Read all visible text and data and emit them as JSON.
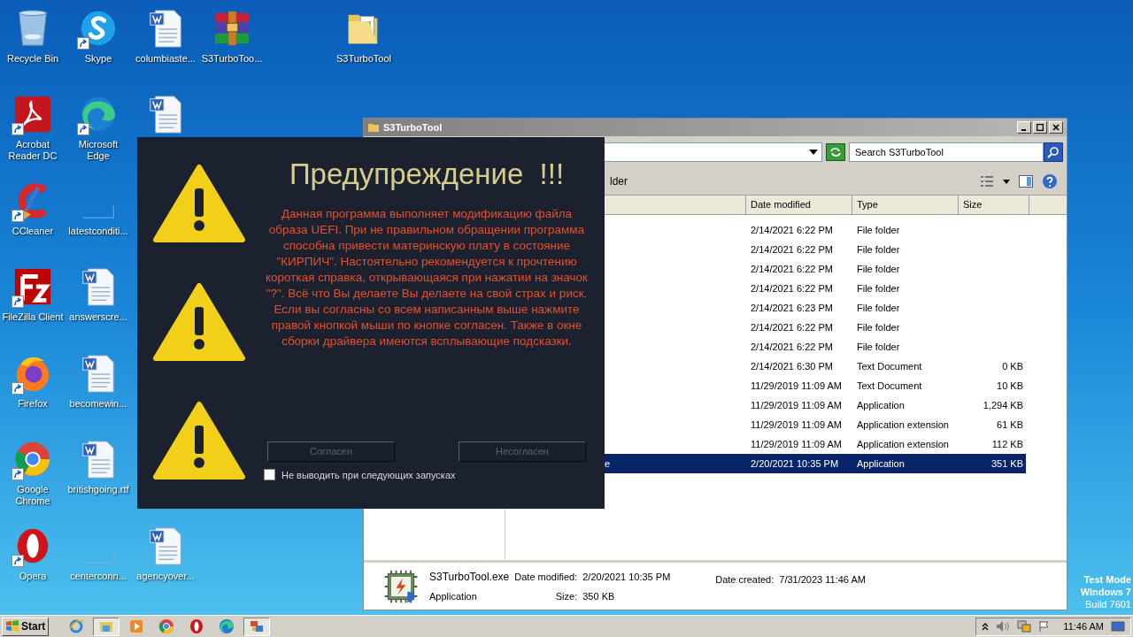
{
  "desktop": {
    "icons": [
      {
        "label": "Recycle Bin",
        "kind": "recycle",
        "shortcut": false
      },
      {
        "label": "Skype",
        "kind": "skype",
        "shortcut": true
      },
      {
        "label": "columbiaste...",
        "kind": "word",
        "shortcut": false
      },
      {
        "label": "S3TurboToo...",
        "kind": "archive",
        "shortcut": false
      },
      {
        "label": "S3TurboTool",
        "kind": "folder",
        "shortcut": false
      },
      {
        "label": "Acrobat Reader DC",
        "kind": "acrobat",
        "shortcut": true
      },
      {
        "label": "Microsoft Edge",
        "kind": "edge",
        "shortcut": true
      },
      {
        "kind": "word",
        "shortcut": false
      },
      {
        "label": "CCleaner",
        "kind": "ccleaner",
        "shortcut": true
      },
      {
        "label": "latestconditi...",
        "kind": "blank",
        "shortcut": false
      },
      {
        "label": "FileZilla Client",
        "kind": "filezilla",
        "shortcut": true
      },
      {
        "label": "answerscre...",
        "kind": "word",
        "shortcut": false
      },
      {
        "label": "Firefox",
        "kind": "firefox",
        "shortcut": true
      },
      {
        "label": "becomewin...",
        "kind": "word",
        "shortcut": false
      },
      {
        "label": "Google Chrome",
        "kind": "chrome",
        "shortcut": true
      },
      {
        "label": "britishgoing.rtf",
        "kind": "word",
        "shortcut": false
      },
      {
        "label": "Opera",
        "kind": "opera",
        "shortcut": true
      },
      {
        "label": "centerconn...",
        "kind": "blank",
        "shortcut": false
      },
      {
        "label": "agencyover...",
        "kind": "word",
        "shortcut": false
      }
    ],
    "watermark_text": [
      "Test Mode",
      "Windows 7",
      "Build 7601"
    ]
  },
  "explorer": {
    "title": "S3TurboTool",
    "search": {
      "placeholder": "Search S3TurboTool"
    },
    "toolbar_text": "lder",
    "columns": [
      "Date modified",
      "Type",
      "Size"
    ],
    "rows": [
      {
        "date": "2/14/2021 6:22 PM",
        "type": "File folder",
        "selected": false
      },
      {
        "date": "2/14/2021 6:22 PM",
        "type": "File folder",
        "selected": false
      },
      {
        "date": "2/14/2021 6:22 PM",
        "type": "File folder",
        "selected": false
      },
      {
        "date": "2/14/2021 6:22 PM",
        "type": "File folder",
        "selected": false
      },
      {
        "date": "2/14/2021 6:23 PM",
        "type": "File folder",
        "selected": false
      },
      {
        "date": "2/14/2021 6:22 PM",
        "type": "File folder",
        "selected": false
      },
      {
        "date": "2/14/2021 6:22 PM",
        "type": "File folder",
        "selected": false
      },
      {
        "date": "2/14/2021 6:30 PM",
        "type": "Text Document",
        "size": "0 KB",
        "selected": false
      },
      {
        "date": "11/29/2019 11:09 AM",
        "type": "Text Document",
        "size": "10 KB",
        "selected": false
      },
      {
        "date": "11/29/2019 11:09 AM",
        "type": "Application",
        "size": "1,294 KB",
        "selected": false
      },
      {
        "date": "11/29/2019 11:09 AM",
        "type": "Application extension",
        "size": "61 KB",
        "selected": false
      },
      {
        "date": "11/29/2019 11:09 AM",
        "type": "Application extension",
        "size": "112 KB",
        "selected": false
      },
      {
        "name": "e",
        "date": "2/20/2021 10:35 PM",
        "type": "Application",
        "size": "351 KB",
        "selected": true
      }
    ],
    "details": {
      "name": "S3TurboTool.exe",
      "type": "Application",
      "modified_label": "Date modified:",
      "modified": "2/20/2021 10:35 PM",
      "size_label": "Size:",
      "size": "350 KB",
      "created_label": "Date created:",
      "created": "7/31/2023 11:46 AM"
    }
  },
  "dialog": {
    "title": "Предупреждение  !!!",
    "body": "Данная программа выполняет модификацию файла образа UEFI. При не правильном обращении программа способна привести материнскую плату в состояние \"КИРПИЧ\". Настоятельно рекомендуется к прочтению короткая справка, открывающаяся при нажатии на значок \"?\". Всё что Вы делаете Вы делаете на свой страх и риск. Если вы согласны со всем написанным выше нажмите правой кнопкой мыши по кнопке согласен. Также в окне сборки драйвера имеются всплывающие подсказки.",
    "buttons": [
      "Согласен",
      "Несогласен"
    ],
    "checkbox": {
      "label": "Не выводить при следующих запусках",
      "checked": false
    }
  },
  "taskbar": {
    "start": "Start",
    "apps": [
      {
        "kind": "ie",
        "active": false
      },
      {
        "kind": "explorer",
        "active": true
      },
      {
        "kind": "media",
        "active": false
      },
      {
        "kind": "chrome",
        "active": false
      },
      {
        "kind": "opera",
        "active": false
      },
      {
        "kind": "edge",
        "active": false
      },
      {
        "kind": "app",
        "active": true
      }
    ],
    "time": "11:46 AM"
  }
}
